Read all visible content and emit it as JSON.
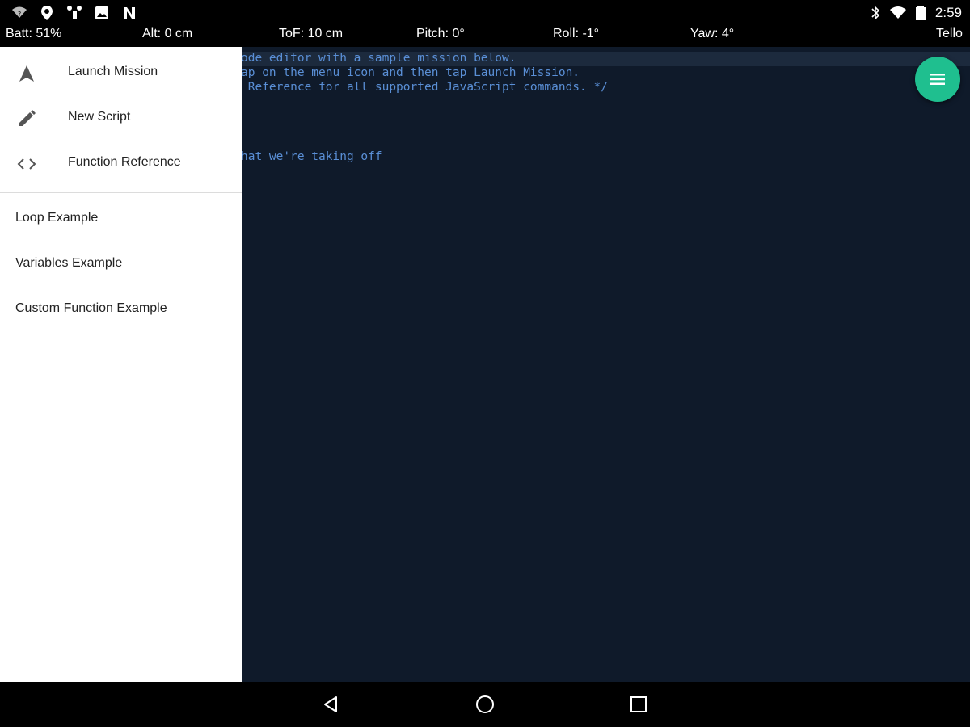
{
  "status_bar": {
    "time": "2:59",
    "left_icons": [
      "wifi-signal-icon",
      "location-icon",
      "network-icon",
      "image-icon",
      "n-icon"
    ],
    "right_icons": [
      "bluetooth-icon",
      "wifi-icon",
      "battery-icon"
    ]
  },
  "telemetry": {
    "battery": "Batt: 51%",
    "altitude": "Alt: 0 cm",
    "tof": "ToF: 10 cm",
    "pitch": "Pitch: 0°",
    "roll": "Roll: -1°",
    "yaw": "Yaw: 4°",
    "drone_name": "Tello"
  },
  "editor": {
    "lines": [
      "ode editor with a sample mission below.",
      "ap on the menu icon and then tap Launch Mission.",
      " Reference for all supported JavaScript commands. */",
      "",
      "",
      "hat we're taking off"
    ]
  },
  "fab": {
    "icon": "hamburger-menu-icon"
  },
  "drawer": {
    "menu_items": [
      {
        "label": "Launch Mission",
        "icon": "navigation-arrow-icon"
      },
      {
        "label": "New Script",
        "icon": "pencil-icon"
      },
      {
        "label": "Function Reference",
        "icon": "code-brackets-icon"
      }
    ],
    "examples": [
      {
        "label": "Loop Example"
      },
      {
        "label": "Variables Example"
      },
      {
        "label": "Custom Function Example"
      }
    ]
  },
  "nav_bar": {
    "buttons": [
      "back-icon",
      "home-icon",
      "recents-icon"
    ]
  },
  "colors": {
    "editor_bg": "#0f1a2a",
    "code_text": "#5a8fd6",
    "fab": "#1fbf8f",
    "drawer_bg": "#ffffff",
    "bar_bg": "#000000"
  }
}
